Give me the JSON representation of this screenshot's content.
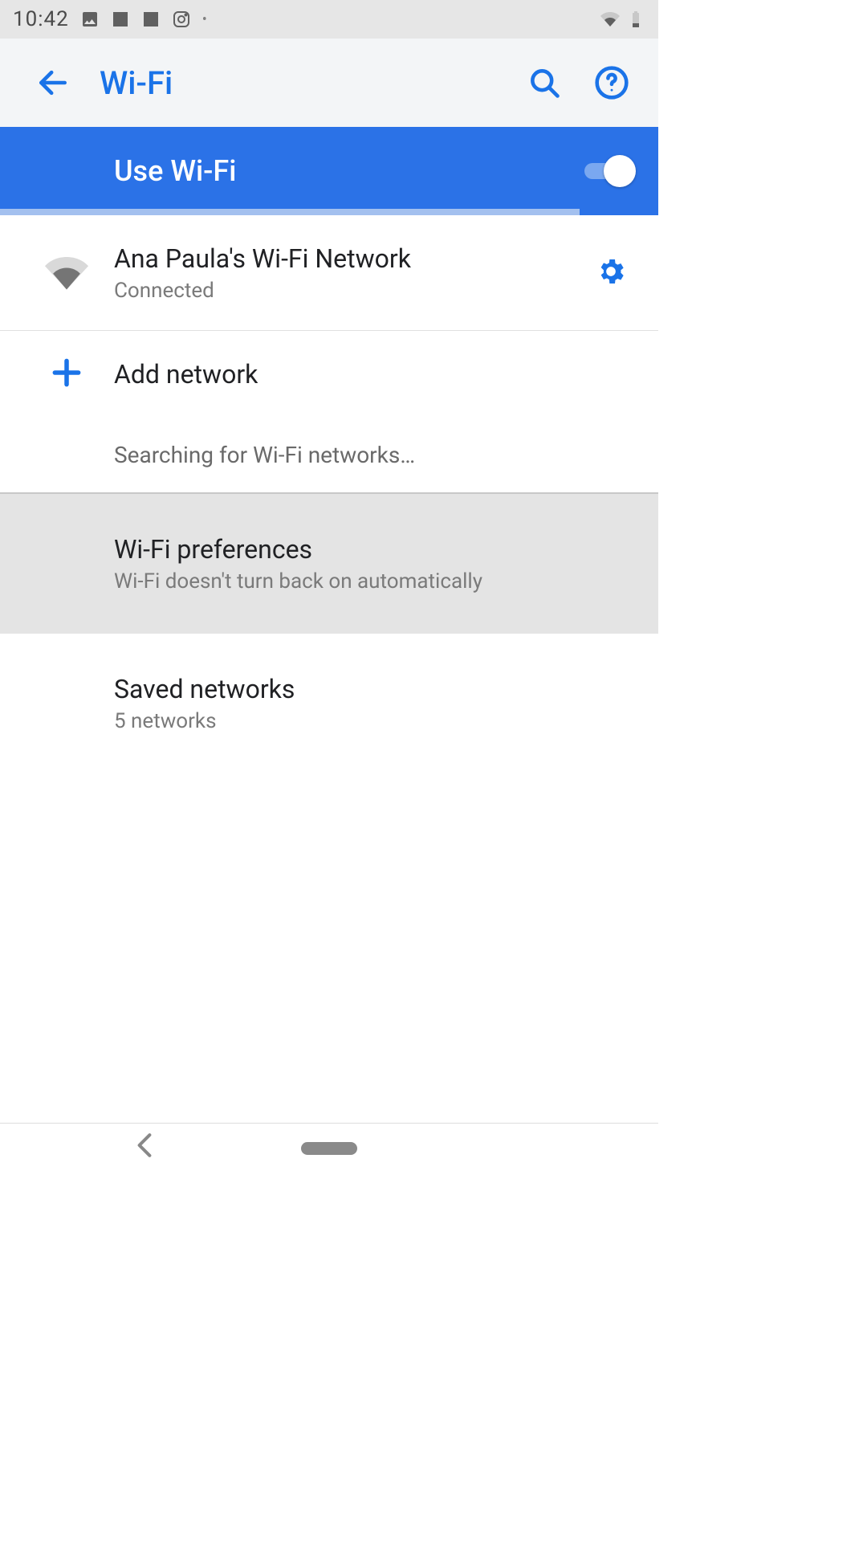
{
  "statusbar": {
    "time": "10:42"
  },
  "appbar": {
    "title": "Wi-Fi"
  },
  "toggle": {
    "label": "Use Wi-Fi",
    "enabled": true
  },
  "connected": {
    "ssid": "Ana Paula's Wi-Fi Network",
    "status": "Connected"
  },
  "add_network_label": "Add network",
  "searching_label": "Searching for Wi-Fi networks…",
  "preferences": {
    "title": "Wi-Fi preferences",
    "subtitle": "Wi-Fi doesn't turn back on automatically"
  },
  "saved": {
    "title": "Saved networks",
    "subtitle": "5 networks"
  }
}
